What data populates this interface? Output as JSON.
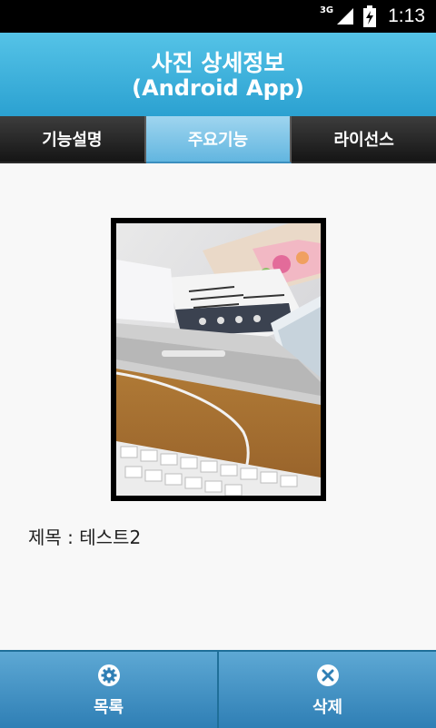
{
  "status_bar": {
    "network": "3G",
    "time": "1:13"
  },
  "header": {
    "title": "사진 상세정보",
    "subtitle": "(Android App)"
  },
  "tabs": [
    {
      "label": "기능설명",
      "active": false
    },
    {
      "label": "주요기능",
      "active": true
    },
    {
      "label": "라이선스",
      "active": false
    }
  ],
  "photo": {
    "alt": "테스트2"
  },
  "detail": {
    "title_line": "제목 : 테스트2"
  },
  "bottom_bar": {
    "list_label": "목록",
    "list_icon": "gear-icon",
    "delete_label": "삭제",
    "delete_icon": "close-icon"
  },
  "colors": {
    "header": "#2ba1d1",
    "tab_active": "#62b6e0",
    "bottom_bar": "#2f7fb5"
  }
}
